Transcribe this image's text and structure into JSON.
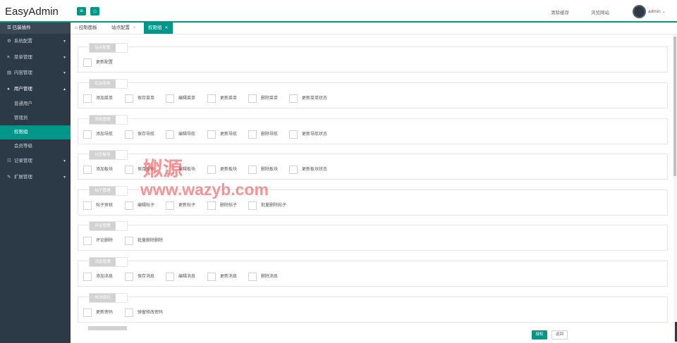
{
  "header": {
    "logo": "EasyAdmin",
    "menu_icon": "bars-icon",
    "home_icon": "home-icon",
    "clear_cache": "清除缓存",
    "browse_site": "浏览网站",
    "username": "admin ⌄"
  },
  "sidebar": {
    "header": "已装插件",
    "items": [
      {
        "label": "系统配置",
        "icon": "gear-icon"
      },
      {
        "label": "菜单管理",
        "icon": "list-icon"
      },
      {
        "label": "内容管理",
        "icon": "document-icon"
      },
      {
        "label": "用户管理",
        "icon": "users-icon"
      },
      {
        "label": "记录管理",
        "icon": "record-icon"
      },
      {
        "label": "扩展管理",
        "icon": "wrench-icon"
      }
    ],
    "subitems": [
      "普通用户",
      "管理员",
      "权限组",
      "会员等级"
    ]
  },
  "tabs": [
    {
      "label": "控制面板"
    },
    {
      "label": "站点配置"
    },
    {
      "label": "权限组"
    }
  ],
  "groups": [
    {
      "title": "站点配置",
      "items": [
        "更新配置"
      ]
    },
    {
      "title": "后台菜单",
      "items": [
        "添加菜单",
        "保存菜单",
        "编辑菜单",
        "更新菜单",
        "删除菜单",
        "更新菜单状态"
      ]
    },
    {
      "title": "导航管理",
      "items": [
        "添加导航",
        "保存导航",
        "编辑导航",
        "更新导航",
        "删除导航",
        "更新导航状态"
      ]
    },
    {
      "title": "社区板块",
      "items": [
        "添加板块",
        "保存板块",
        "编辑板块",
        "更新板块",
        "删除板块",
        "更新板块状态"
      ]
    },
    {
      "title": "帖子管理",
      "items": [
        "帖子审核",
        "编辑帖子",
        "更新帖子",
        "删除帖子",
        "批量删除帖子"
      ]
    },
    {
      "title": "评论管理",
      "items": [
        "评论删除",
        "批量删除删除"
      ]
    },
    {
      "title": "消息管理",
      "items": [
        "添加消息",
        "保存消息",
        "编辑消息",
        "更新消息",
        "删除消息"
      ]
    },
    {
      "title": "修改密码",
      "items": [
        "更新密码",
        "弹窗修改密码"
      ]
    }
  ],
  "buttons": {
    "authorize": "授权",
    "back": "返回"
  },
  "watermark": {
    "line1": "娰源",
    "line2": "www.wazyb.com"
  },
  "colors": {
    "accent": "#009688",
    "sidebar_bg": "#2c3a47"
  }
}
